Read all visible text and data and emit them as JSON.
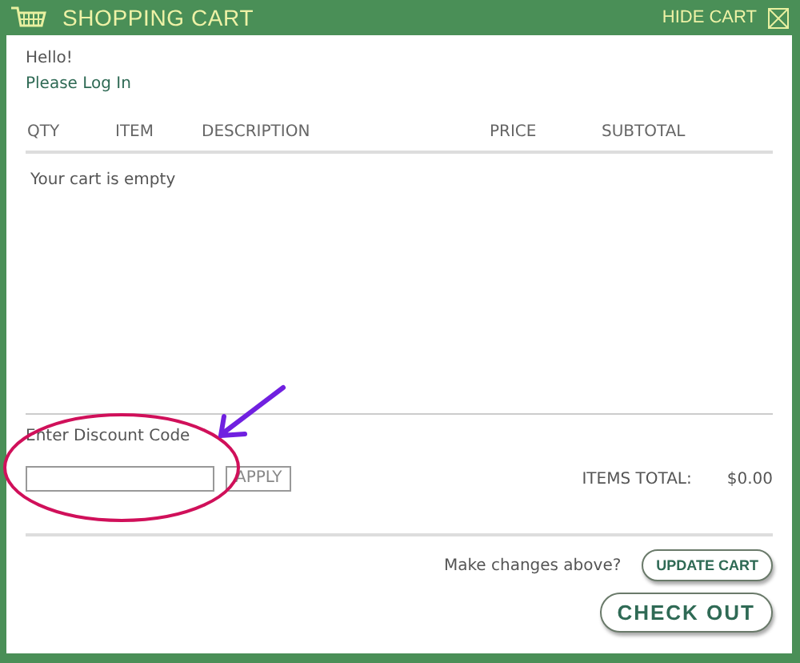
{
  "header": {
    "title": "SHOPPING CART",
    "hide_label": "HIDE CART"
  },
  "greeting": "Hello!",
  "login_link": "Please Log In",
  "table": {
    "columns": [
      "QTY",
      "ITEM",
      "DESCRIPTION",
      "PRICE",
      "SUBTOTAL"
    ],
    "empty_message": "Your cart is empty"
  },
  "discount": {
    "label": "Enter Discount Code",
    "apply_button": "APPLY"
  },
  "totals": {
    "label": "ITEMS TOTAL:",
    "value": "$0.00"
  },
  "footer": {
    "prompt": "Make changes above?",
    "update_button": "UPDATE CART",
    "checkout_button": "CHECK OUT"
  }
}
